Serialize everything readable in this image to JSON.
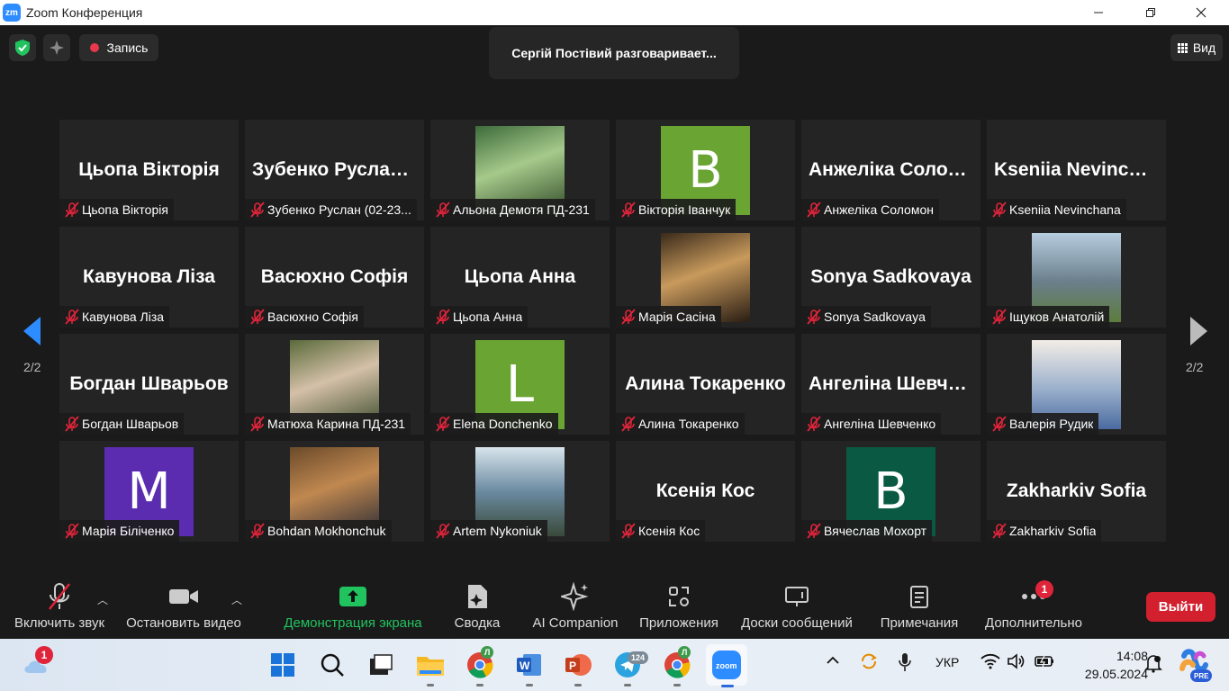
{
  "window": {
    "title": "Zoom Конференция",
    "logo": "zm"
  },
  "topbar": {
    "record_label": "Запись",
    "speaking_text": "Сергій Постівий разговаривает...",
    "view_label": "Вид"
  },
  "paging": {
    "left": "2/2",
    "right": "2/2"
  },
  "participants": [
    {
      "display": "Цьопа Вікторія",
      "label": "Цьопа Вікторія",
      "kind": "text"
    },
    {
      "display": "Зубенко Руслан (02-23...",
      "label": "Зубенко Руслан (02-23...",
      "kind": "text"
    },
    {
      "display": "",
      "label": "Альона Демотя ПД-231",
      "kind": "photo"
    },
    {
      "display": "B",
      "label": "Вікторія Іванчук",
      "kind": "avatar",
      "color": "#6aa534"
    },
    {
      "display": "Анжеліка Соломон",
      "label": "Анжеліка Соломон",
      "kind": "text"
    },
    {
      "display": "Kseniia Nevinchana",
      "label": "Kseniia Nevinchana",
      "kind": "text"
    },
    {
      "display": "Кавунова Ліза",
      "label": "Кавунова Ліза",
      "kind": "text"
    },
    {
      "display": "Васюхно Софія",
      "label": "Васюхно Софія",
      "kind": "text"
    },
    {
      "display": "Цьопа Анна",
      "label": "Цьопа Анна",
      "kind": "text"
    },
    {
      "display": "",
      "label": "Марія Сасіна",
      "kind": "photo"
    },
    {
      "display": "Sonya Sadkovaya",
      "label": "Sonya Sadkovaya",
      "kind": "text"
    },
    {
      "display": "",
      "label": "Іщуков Анатолій",
      "kind": "photo"
    },
    {
      "display": "Богдан Шварьов",
      "label": "Богдан Шварьов",
      "kind": "text"
    },
    {
      "display": "",
      "label": "Матюха Карина ПД-231",
      "kind": "photo"
    },
    {
      "display": "L",
      "label": "Elena Donchenko",
      "kind": "avatar",
      "color": "#6aa534"
    },
    {
      "display": "Алина Токаренко",
      "label": "Алина Токаренко",
      "kind": "text"
    },
    {
      "display": "Ангеліна Шевченко",
      "label": "Ангеліна Шевченко",
      "kind": "text"
    },
    {
      "display": "",
      "label": "Валерія Рудик",
      "kind": "photo"
    },
    {
      "display": "M",
      "label": "Марія Біліченко",
      "kind": "avatar",
      "color": "#5b2bb0"
    },
    {
      "display": "",
      "label": "Bohdan Mokhonchuk",
      "kind": "photo"
    },
    {
      "display": "",
      "label": "Artem Nykoniuk",
      "kind": "photo"
    },
    {
      "display": "Ксенія Кос",
      "label": "Ксенія Кос",
      "kind": "text"
    },
    {
      "display": "B",
      "label": "Вячеслав Мохорт",
      "kind": "avatar",
      "color": "#0a5a43"
    },
    {
      "display": "Zakharkiv Sofia",
      "label": "Zakharkiv Sofia",
      "kind": "text"
    }
  ],
  "toolbar": {
    "unmute": "Включить звук",
    "stop_video": "Остановить видео",
    "share": "Демонстрация экрана",
    "summary": "Сводка",
    "ai": "AI Companion",
    "apps": "Приложения",
    "whiteboards": "Доски сообщений",
    "notes": "Примечания",
    "more": "Дополнительно",
    "more_badge": "1",
    "leave": "Выйти"
  },
  "taskbar": {
    "weather_badge": "1",
    "chrome_badge": "Л",
    "telegram_badge": "124",
    "chrome2_badge": "Л",
    "lang": "УКР",
    "time": "14:08",
    "date": "29.05.2024",
    "copilot_badge": "PRE"
  },
  "colors": {
    "accent_green": "#21c35e",
    "leave_red": "#d2202f",
    "mic_red": "#e0243a",
    "zoom_blue": "#2d8cff"
  }
}
